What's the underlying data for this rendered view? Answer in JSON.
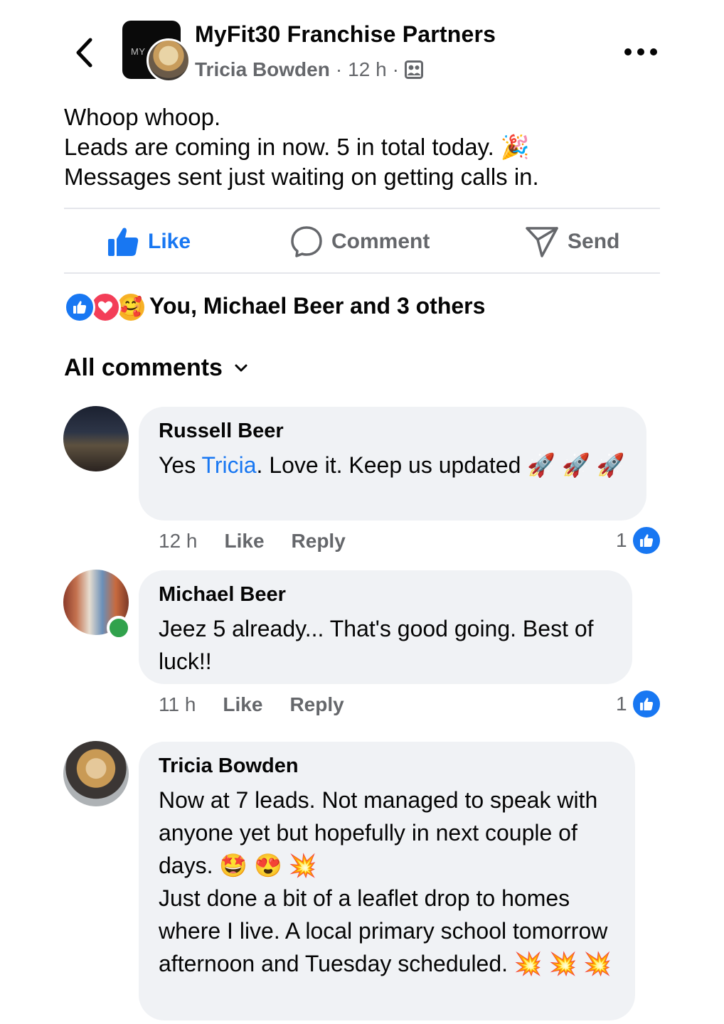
{
  "header": {
    "group_name": "MyFit30 Franchise Partners",
    "group_logo_text": "MY",
    "author": "Tricia Bowden",
    "time": "12 h",
    "separator": "·",
    "back_icon": "chevron-left-icon",
    "audience_icon": "group-members-icon",
    "more_icon": "more-icon"
  },
  "post": {
    "lines": [
      "Whoop whoop.",
      "Leads are coming in now. 5 in total today. 🎉",
      "Messages sent just waiting on getting calls in."
    ]
  },
  "actions": {
    "like": "Like",
    "comment": "Comment",
    "send": "Send"
  },
  "reactions": {
    "summary": "You, Michael Beer and 3 others",
    "types": [
      "like",
      "love",
      "care"
    ],
    "care_emoji": "🥰"
  },
  "comments_section": {
    "filter_label": "All comments"
  },
  "comments": [
    {
      "author": "Russell Beer",
      "text_before": "Yes ",
      "mention": "Tricia",
      "text_after": ". Love it. Keep us updated 🚀 🚀 🚀",
      "time": "12 h",
      "like": "Like",
      "reply": "Reply",
      "like_count": "1"
    },
    {
      "author": "Michael Beer",
      "text": "Jeez 5 already... That's good going. Best of luck!!",
      "time": "11 h",
      "like": "Like",
      "reply": "Reply",
      "like_count": "1",
      "online": true
    },
    {
      "author": "Tricia Bowden",
      "text_line1": "Now at 7 leads. Not managed to speak with anyone yet but hopefully in next couple of days. 🤩 😍 💥",
      "text_line2": "Just done a bit of a leaflet drop to homes where I live. A local primary school tomorrow afternoon and Tuesday scheduled. 💥 💥 💥"
    }
  ],
  "colors": {
    "accent": "#1877f2",
    "secondary_text": "#65676b",
    "bubble": "#f0f2f5",
    "love": "#f33e58",
    "online": "#31a24c"
  }
}
